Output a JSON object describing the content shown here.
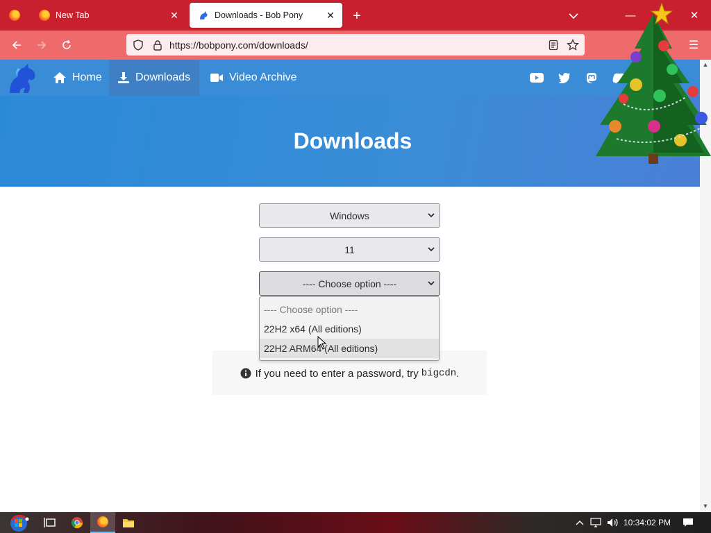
{
  "browser": {
    "tabs": [
      {
        "title": "New Tab",
        "active": false
      },
      {
        "title": "Downloads - Bob Pony",
        "active": true
      }
    ],
    "url": "https://bobpony.com/downloads/",
    "colors": {
      "tabbar": "#c8202e",
      "toolbar": "#ef6a6a"
    }
  },
  "site": {
    "nav": [
      {
        "label": "Home",
        "icon": "home-icon",
        "active": false
      },
      {
        "label": "Downloads",
        "icon": "download-icon",
        "active": true
      },
      {
        "label": "Video Archive",
        "icon": "video-icon",
        "active": false
      }
    ],
    "social": [
      "youtube-icon",
      "twitter-icon",
      "mastodon-icon",
      "discord-icon"
    ],
    "hero_title": "Downloads",
    "selects": {
      "os": "Windows",
      "version": "11",
      "build": "---- Choose option ----"
    },
    "dropdown_options": [
      "---- Choose option ----",
      "22H2 x64 (All editions)",
      "22H2 ARM64 (All editions)"
    ],
    "hovered_option": "22H2 ARM64 (All editions)",
    "info_text": "If you need to enter a password, try",
    "info_code": "bigcdn",
    "info_end": ".",
    "colors": {
      "nav": "#3a8cd6",
      "hero": "#2b8ad8"
    }
  },
  "taskbar": {
    "time": "10:34:02 PM",
    "apps": [
      "task-view-icon",
      "chrome-icon",
      "firefox-icon",
      "file-explorer-icon"
    ]
  }
}
